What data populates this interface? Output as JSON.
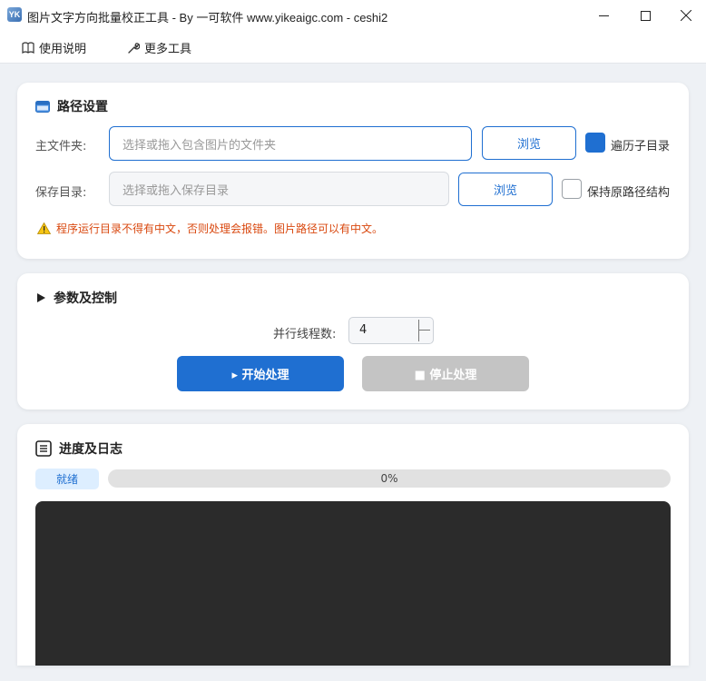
{
  "window": {
    "title": "图片文字方向批量校正工具 - By 一可软件 www.yikeaigc.com - ceshi2",
    "icon_text": "YK"
  },
  "menu": {
    "guide_label": "使用说明",
    "tools_label": "更多工具"
  },
  "path_section": {
    "title": "路径设置",
    "main_folder": {
      "label": "主文件夹:",
      "placeholder": "选择或拖入包含图片的文件夹",
      "value": "",
      "browse_label": "浏览",
      "recursive_label": "遍历子目录",
      "recursive_checked": true
    },
    "save_dir": {
      "label": "保存目录:",
      "placeholder": "选择或拖入保存目录",
      "value": "",
      "browse_label": "浏览",
      "keep_structure_label": "保持原路径结构",
      "keep_structure_checked": false
    },
    "warning": "程序运行目录不得有中文，否则处理会报错。图片路径可以有中文。"
  },
  "params_section": {
    "title": "参数及控制",
    "threads_label": "并行线程数:",
    "threads_value": "4",
    "start_label": "▸ 开始处理",
    "stop_label": "■ 停止处理"
  },
  "log_section": {
    "title": "进度及日志",
    "status": "就绪",
    "progress_percent": 0,
    "progress_text": "0%"
  },
  "colors": {
    "accent": "#1f6fd1",
    "warning": "#d9480f",
    "log_bg": "#2b2b2b",
    "disabled": "#c4c4c4"
  }
}
